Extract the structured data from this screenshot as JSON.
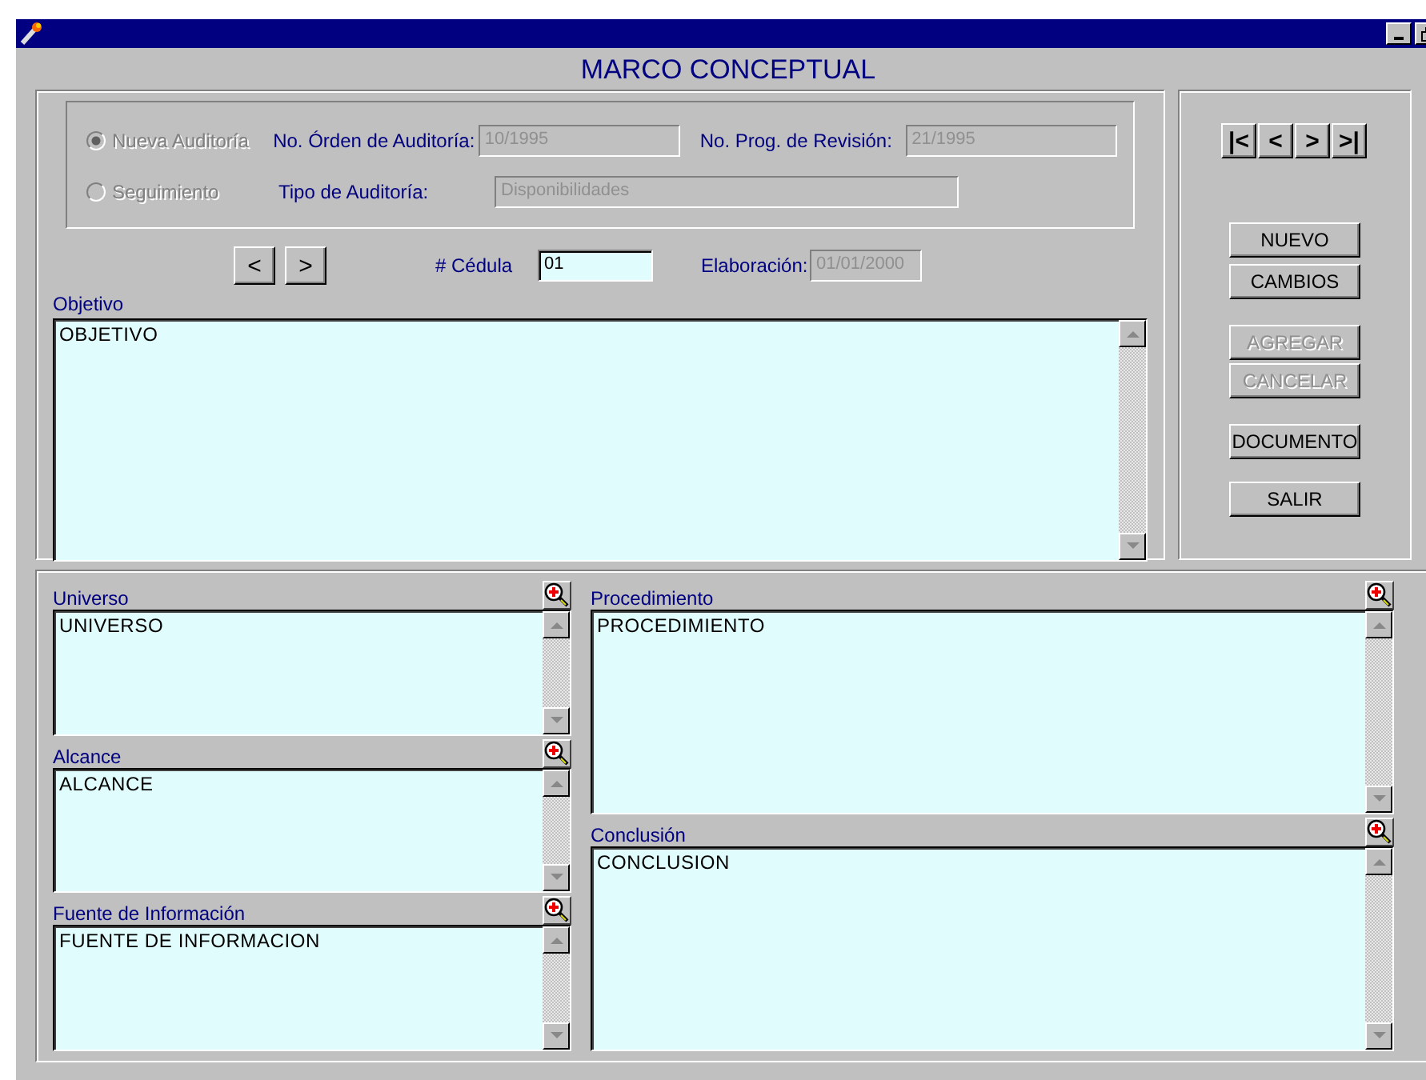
{
  "window": {
    "title": "MARCO CONCEPTUAL"
  },
  "audit": {
    "options": [
      {
        "label": "Nueva Auditoría",
        "selected": true,
        "disabled": true
      },
      {
        "label": "Seguimiento",
        "selected": false,
        "disabled": true
      }
    ],
    "order": {
      "label": "No. Órden de Auditoría:",
      "value": "10/1995",
      "disabled": true
    },
    "review": {
      "label": "No. Prog. de Revisión:",
      "value": "21/1995",
      "disabled": true
    },
    "type": {
      "label": "Tipo de Auditoría:",
      "value": "Disponibilidades",
      "disabled": true
    }
  },
  "record_nav": [
    "<",
    ">"
  ],
  "cedula": {
    "label": "# Cédula",
    "value": "01",
    "disabled": false
  },
  "elaboracion": {
    "label": "Elaboración:",
    "value": "01/01/2000",
    "disabled": true
  },
  "objective": {
    "label": "Objetivo",
    "value": "OBJETIVO"
  },
  "nav_buttons": [
    "|<",
    "<",
    ">",
    ">|"
  ],
  "buttons": [
    {
      "label": "NUEVO",
      "disabled": false
    },
    {
      "label": "CAMBIOS",
      "disabled": false
    },
    {
      "label": "AGREGAR",
      "disabled": true
    },
    {
      "label": "CANCELAR",
      "disabled": true
    },
    {
      "label": "DOCUMENTO",
      "disabled": false
    },
    {
      "label": "SALIR",
      "disabled": false
    }
  ],
  "left_memos": [
    {
      "label": "Universo",
      "value": "UNIVERSO"
    },
    {
      "label": "Alcance",
      "value": "ALCANCE"
    },
    {
      "label": "Fuente de Información",
      "value": "FUENTE DE INFORMACION"
    }
  ],
  "right_memos": [
    {
      "label": "Procedimiento",
      "value": "PROCEDIMIENTO"
    },
    {
      "label": "Conclusión",
      "value": "CONCLUSION"
    }
  ]
}
